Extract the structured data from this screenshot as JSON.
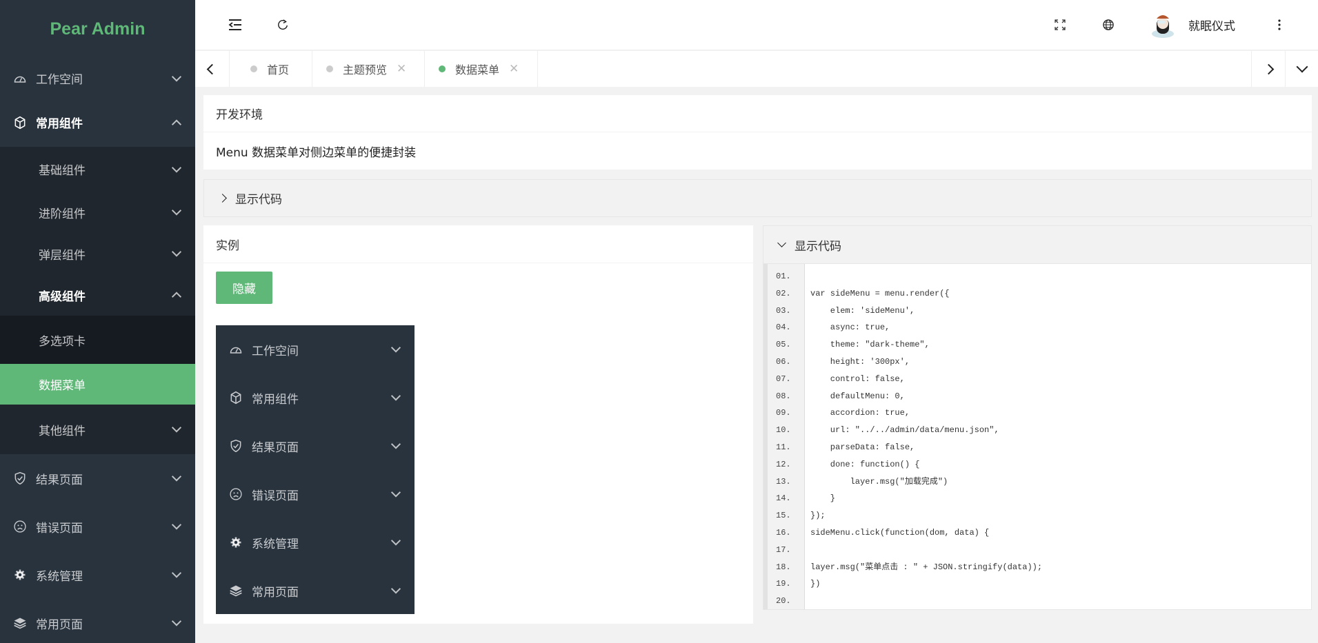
{
  "app": {
    "logo": "Pear Admin",
    "accent": "#5fb878"
  },
  "sidebar": {
    "items": [
      {
        "label": "工作空间",
        "icon": "dashboard-icon"
      },
      {
        "label": "常用组件",
        "icon": "cube-icon",
        "open": true,
        "children": [
          {
            "label": "基础组件"
          },
          {
            "label": "进阶组件"
          },
          {
            "label": "弹层组件"
          },
          {
            "label": "高级组件",
            "open": true,
            "children": [
              {
                "label": "多选项卡"
              },
              {
                "label": "数据菜单",
                "active": true
              }
            ]
          },
          {
            "label": "其他组件"
          }
        ]
      },
      {
        "label": "结果页面",
        "icon": "shield-check-icon"
      },
      {
        "label": "错误页面",
        "icon": "sad-face-icon"
      },
      {
        "label": "系统管理",
        "icon": "gear-icon"
      },
      {
        "label": "常用页面",
        "icon": "layers-icon"
      }
    ]
  },
  "header": {
    "user": "就眠仪式"
  },
  "tabs": [
    {
      "label": "首页",
      "closable": false
    },
    {
      "label": "主题预览",
      "closable": true
    },
    {
      "label": "数据菜单",
      "closable": true,
      "active": true
    }
  ],
  "intro": {
    "title": "开发环境",
    "desc": "Menu 数据菜单对侧边菜单的便捷封装"
  },
  "collapse": {
    "label": "显示代码"
  },
  "example": {
    "title": "实例",
    "button": "隐藏",
    "menu": [
      "工作空间",
      "常用组件",
      "结果页面",
      "错误页面",
      "系统管理",
      "常用页面"
    ]
  },
  "code": {
    "title": "显示代码",
    "lines": [
      "",
      "var sideMenu = menu.render({",
      "    elem: 'sideMenu',",
      "    async: true,",
      "    theme: \"dark-theme\",",
      "    height: '300px',",
      "    control: false,",
      "    defaultMenu: 0,",
      "    accordion: true,",
      "    url: \"../../admin/data/menu.json\",",
      "    parseData: false,",
      "    done: function() {",
      "        layer.msg(\"加载完成\")",
      "    }",
      "});",
      "sideMenu.click(function(dom, data) {",
      "",
      "layer.msg(\"菜单点击 : \" + JSON.stringify(data));",
      "})",
      ""
    ]
  }
}
